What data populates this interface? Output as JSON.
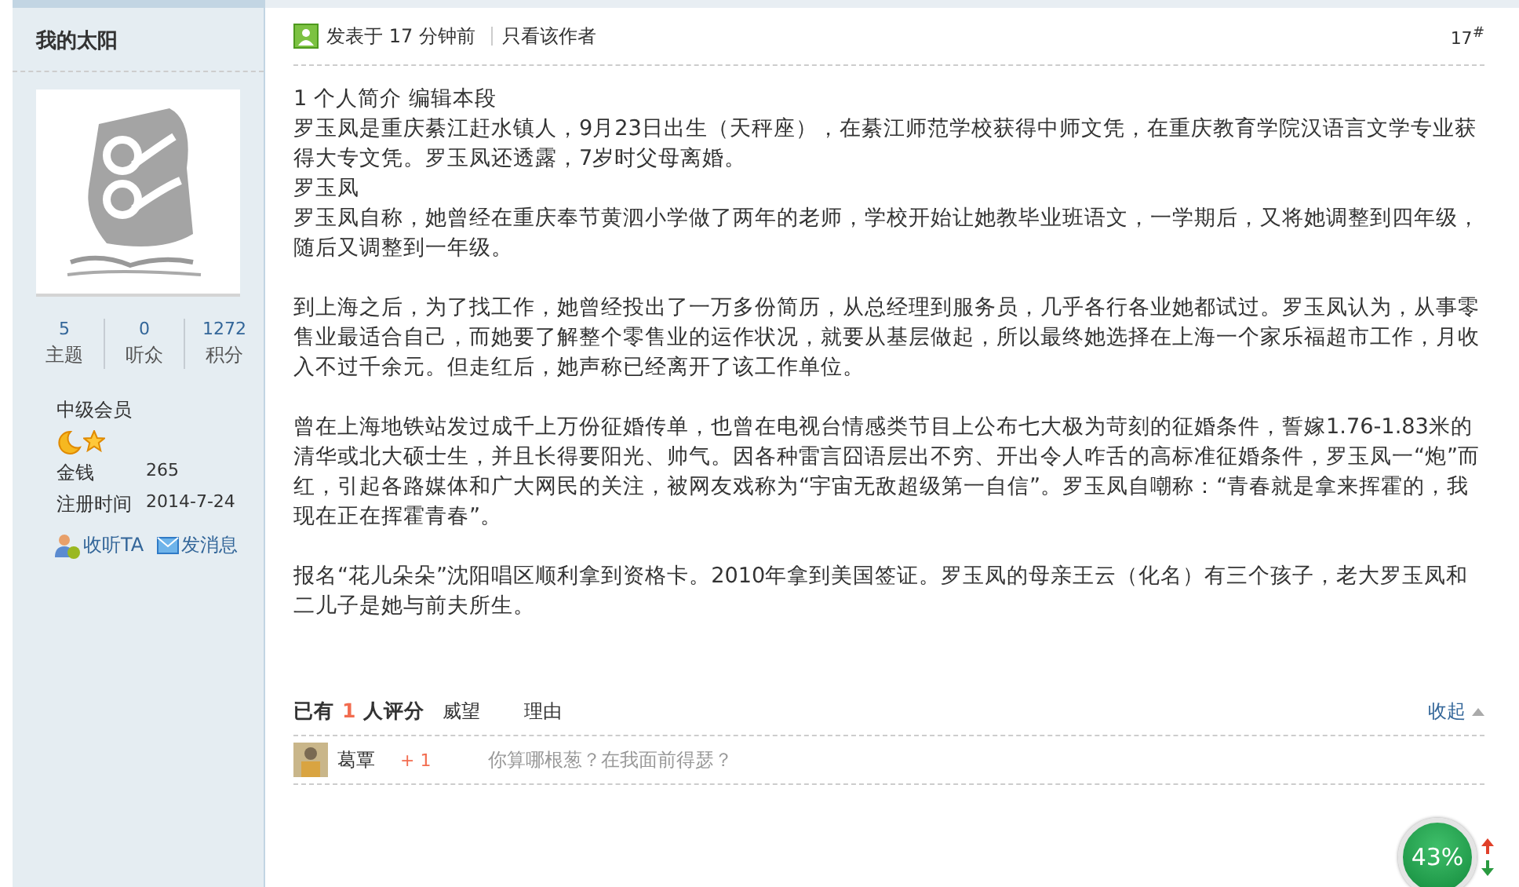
{
  "sidebar": {
    "username": "我的太阳",
    "stats": [
      {
        "value": "5",
        "label": "主题"
      },
      {
        "value": "0",
        "label": "听众"
      },
      {
        "value": "1272",
        "label": "积分"
      }
    ],
    "rank": "中级会员",
    "fields": [
      {
        "label": "金钱",
        "value": "265"
      },
      {
        "label": "注册时间",
        "value": "2014-7-24"
      }
    ],
    "actions": [
      {
        "kind": "follow",
        "label": "收听TA"
      },
      {
        "kind": "message",
        "label": "发消息"
      }
    ]
  },
  "post": {
    "posted": "发表于 17 分钟前",
    "author_only": "只看该作者",
    "floor": "17$^{#}$",
    "content": [
      {
        "lines": [
          "1 个人简介 编辑本段",
          "罗玉凤是重庆綦江赶水镇人，9月23日出生（天秤座），在綦江师范学校获得中师文凭，在重庆教育学院汉语言文学专业获得大专文凭。罗玉凤还透露，7岁时父母离婚。",
          "罗玉凤",
          "罗玉凤自称，她曾经在重庆奉节黄泗小学做了两年的老师，学校开始让她教毕业班语文，一学期后，又将她调整到四年级，随后又调整到一年级。"
        ]
      },
      {
        "lines": [
          "到上海之后，为了找工作，她曾经投出了一万多份简历，从总经理到服务员，几乎各行各业她都试过。罗玉凤认为，从事零售业最适合自己，而她要了解整个零售业的运作状况，就要从基层做起，所以最终她选择在上海一个家乐福超市工作，月收入不过千余元。但走红后，她声称已经离开了该工作单位。"
        ]
      },
      {
        "lines": [
          "曾在上海地铁站发过成千上万份征婚传单，也曾在电视台情感类节目上公布七大极为苛刻的征婚条件，誓嫁1.76-1.83米的清华或北大硕士生，并且长得要阳光、帅气。因各种雷言囧语层出不穷、开出令人咋舌的高标准征婚条件，罗玉凤一“炮”而红，引起各路媒体和广大网民的关注，被网友戏称为“宇宙无敌超级第一自信”。罗玉凤自嘲称：“青春就是拿来挥霍的，我现在正在挥霍青春”。"
        ]
      },
      {
        "lines": [
          "报名“花儿朵朵”沈阳唱区顺利拿到资格卡。2010年拿到美国签证。罗玉凤的母亲王云（化名）有三个孩子，老大罗玉凤和二儿子是她与前夫所生。"
        ]
      }
    ]
  },
  "rating": {
    "prefix": "已有",
    "count": "1",
    "suffix": "人评分",
    "columns": [
      "威望",
      "理由"
    ],
    "collapse": "收起",
    "rows": [
      {
        "user": "葛覃",
        "score": "+ 1",
        "reason": "你算哪根葱？在我面前得瑟？"
      }
    ]
  },
  "widget": {
    "percent": "43%"
  }
}
